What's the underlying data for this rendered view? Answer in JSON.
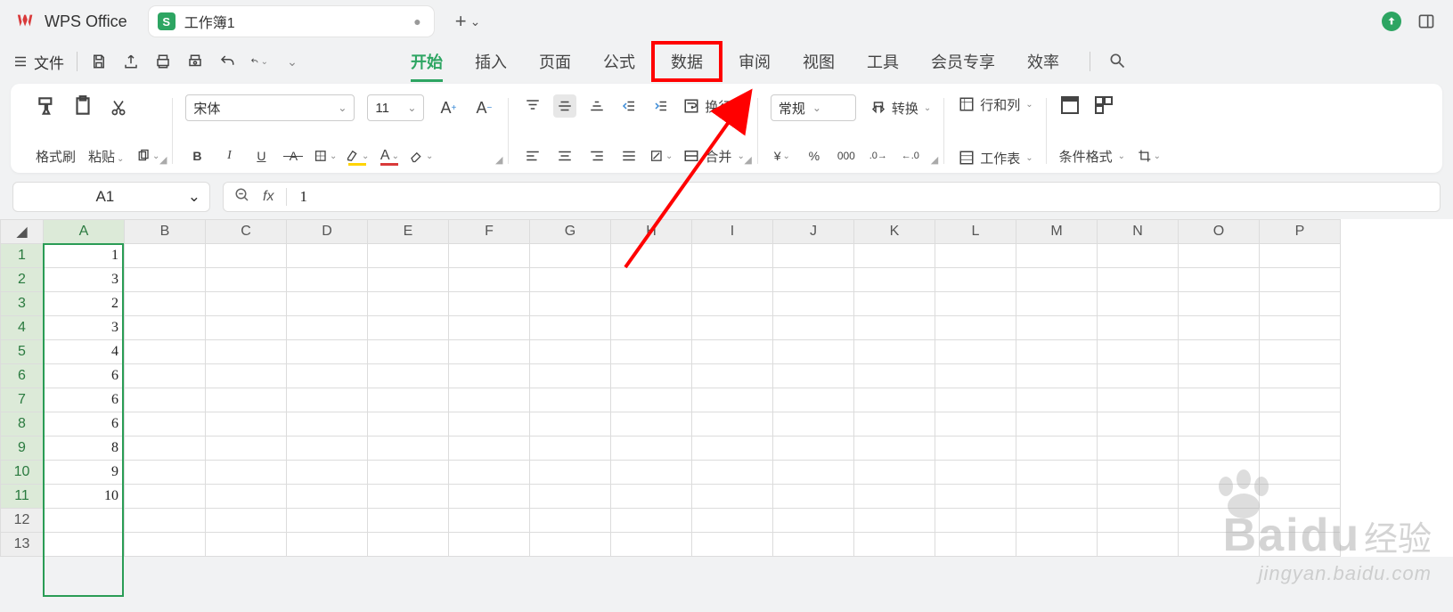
{
  "app": {
    "name": "WPS Office",
    "logo_letter": "W"
  },
  "doc_tab": {
    "icon_letter": "S",
    "name": "工作簿1",
    "modified_dot": "●"
  },
  "new_tab": {
    "plus": "+",
    "chev": "⌄"
  },
  "file_button": {
    "label": "文件"
  },
  "main_tabs": {
    "items": [
      {
        "label": "开始",
        "active": true
      },
      {
        "label": "插入"
      },
      {
        "label": "页面"
      },
      {
        "label": "公式"
      },
      {
        "label": "数据",
        "highlighted": true
      },
      {
        "label": "审阅"
      },
      {
        "label": "视图"
      },
      {
        "label": "工具"
      },
      {
        "label": "会员专享"
      },
      {
        "label": "效率"
      }
    ]
  },
  "ribbon": {
    "format_painter": "格式刷",
    "paste": "粘贴",
    "font_name": "宋体",
    "font_size": "11",
    "bold": "B",
    "italic": "I",
    "underline": "U",
    "number_format": "常规",
    "wrap": "换行",
    "merge": "合并",
    "convert": "转换",
    "rows_cols": "行和列",
    "worksheet": "工作表",
    "cond_format": "条件格式",
    "currency": "¥",
    "percent": "%"
  },
  "namebox": {
    "ref": "A1"
  },
  "formula": {
    "fx": "fx",
    "value": "1"
  },
  "columns": [
    "A",
    "B",
    "C",
    "D",
    "E",
    "F",
    "G",
    "H",
    "I",
    "J",
    "K",
    "L",
    "M",
    "N",
    "O",
    "P"
  ],
  "row_count": 13,
  "selected_column_index": 0,
  "selected_row_count": 11,
  "cells": {
    "A": [
      "1",
      "3",
      "2",
      "3",
      "4",
      "6",
      "6",
      "6",
      "8",
      "9",
      "10"
    ]
  },
  "watermark": {
    "brand_en": "Bai",
    "brand_du": "du",
    "brand_cn": "经验",
    "url": "jingyan.baidu.com"
  },
  "colors": {
    "accent": "#2da562",
    "highlight_border": "#ff0000"
  }
}
